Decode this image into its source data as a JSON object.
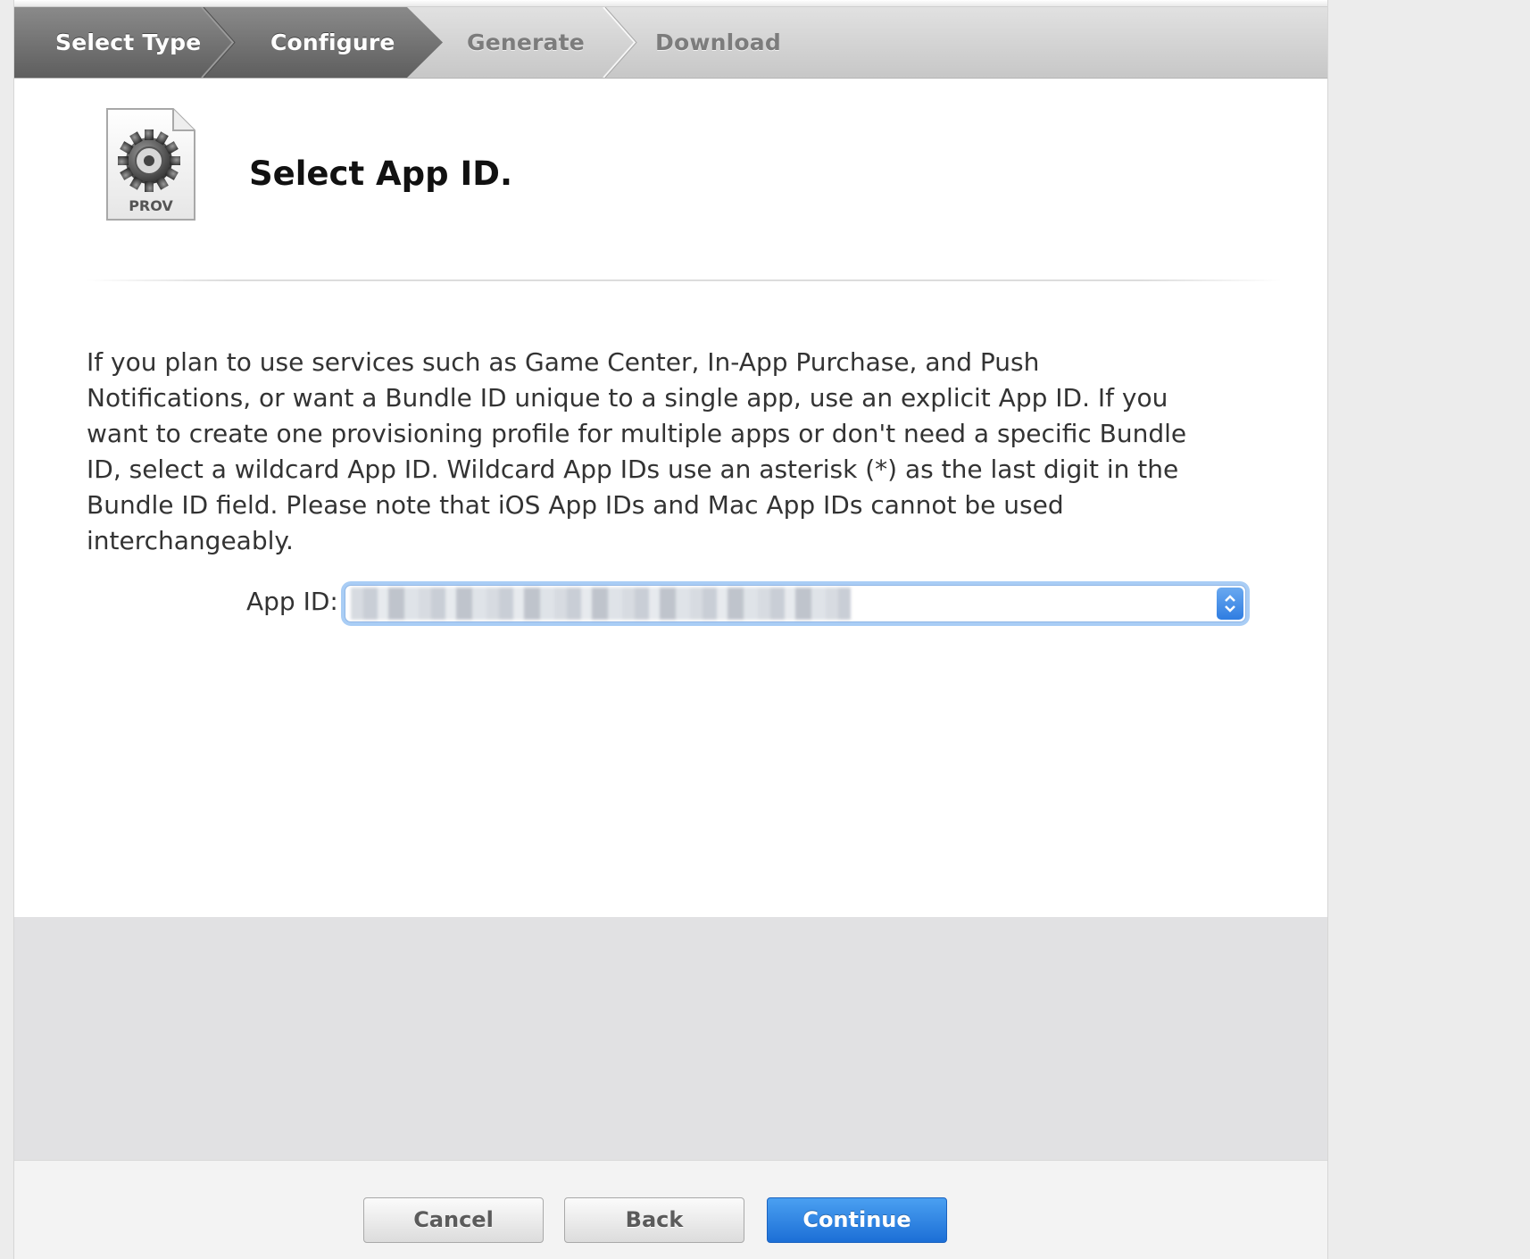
{
  "steps": [
    {
      "label": "Select Type",
      "state": "done"
    },
    {
      "label": "Configure",
      "state": "active"
    },
    {
      "label": "Generate",
      "state": "todo"
    },
    {
      "label": "Download",
      "state": "todo"
    }
  ],
  "header": {
    "icon_label": "PROV",
    "title": "Select App ID."
  },
  "description": "If you plan to use services such as Game Center, In-App Purchase, and Push Notifications, or want a Bundle ID unique to a single app, use an explicit App ID. If you want to create one provisioning profile for multiple apps or don't need a specific Bundle ID, select a wildcard App ID. Wildcard App IDs use an asterisk (*) as the last digit in the Bundle ID field. Please note that iOS App IDs and Mac App IDs cannot be used interchangeably.",
  "form": {
    "app_id_label": "App ID:",
    "app_id_value": ""
  },
  "buttons": {
    "cancel": "Cancel",
    "back": "Back",
    "continue": "Continue"
  },
  "colors": {
    "active_step_bg": "#6d6d6d",
    "primary_button": "#2a7de0",
    "focus_ring": "#a9cdf5"
  }
}
